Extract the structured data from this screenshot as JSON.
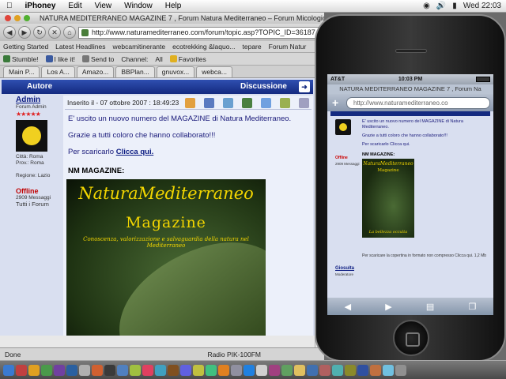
{
  "menubar": {
    "apple": "",
    "app": "iPhoney",
    "items": [
      "Edit",
      "View",
      "Window",
      "Help"
    ],
    "clock": "Wed 22:03"
  },
  "browser": {
    "title": "NATURA MEDITERRANEO MAGAZINE 7 , Forum Natura Mediterraneo – Forum Micologico – Forum Na",
    "url": "http://www.naturamediterraneo.com/forum/topic.asp?TOPIC_ID=36187",
    "bookmarks": [
      "Getting Started",
      "Latest Headlines",
      "webcamitinerante",
      "ecotrekking &laquo...",
      "tepare",
      "Forum Natur"
    ],
    "toolbar": [
      "Stumble!",
      "I like it!",
      "Send to",
      "Channel:",
      "All",
      "Favorites"
    ],
    "tabs": [
      "Main P...",
      "Los A...",
      "Amazo...",
      "BBPlan...",
      "gnuvox...",
      "webca..."
    ],
    "status": "Done",
    "radio": "Radio PIK-100FM"
  },
  "forum": {
    "col_author": "Autore",
    "col_discussion": "Discussione",
    "author_name": "Admin",
    "author_role": "Forum Admin",
    "city_label": "Città: Roma",
    "prov_label": "Prov.: Roma",
    "region_label": "Regione: Lazio",
    "status": "Offline",
    "messages": "2909 Messaggi",
    "all_forums": "Tutti i Forum",
    "posted": "Inserito il - 07 ottobre 2007 : 18:49:23",
    "p1": "E' uscito un nuovo numero del MAGAZINE di Natura Mediterraneo.",
    "p2": "Grazie a tutti coloro che hanno collaborato!!!",
    "p3_pre": "Per scaricarlo",
    "p3_link": "Clicca qui.",
    "nm_label": "NM MAGAZINE:",
    "mag_title1": "NaturaMediterraneo",
    "mag_title2": "Magazine",
    "mag_subtitle": "Conoscenza, valorizzazione e salvaguardia della natura nel Mediterraneo"
  },
  "iphone": {
    "carrier": "AT&T",
    "time": "10:03 PM",
    "title": "NATURA MEDITERRANEO MAGAZINE 7 , Forum Na",
    "url": "http://www.naturamediterraneo.co",
    "p1": "E' uscito un nuovo numero del MAGAZINE di Natura Mediterraneo.",
    "p2": "Grazie a tutti coloro che hanno collaborato!!!",
    "p3": "Per scaricarlo Clicca qui.",
    "nm": "NM MAGAZINE:",
    "cover1": "NaturaMediterraneo",
    "cover2": "Magazine",
    "cover3": "La bellezza occulta",
    "offline": "Offline",
    "messages": "2909 Messaggi",
    "footer": "Per scaricare la copertina in formato non compresso Clicca qui. 1,2 Mb",
    "author2": "Giosuita",
    "author2_role": "Moderatore"
  }
}
